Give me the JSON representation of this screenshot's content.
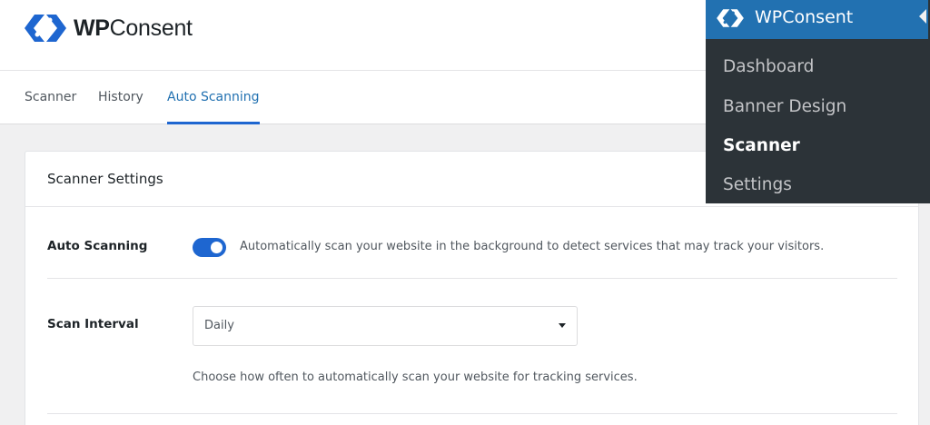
{
  "brand": {
    "name_bold": "WP",
    "name_rest": "Consent"
  },
  "tabs": [
    {
      "label": "Scanner",
      "active": false
    },
    {
      "label": "History",
      "active": false
    },
    {
      "label": "Auto Scanning",
      "active": true
    }
  ],
  "card": {
    "title": "Scanner Settings",
    "auto_scanning": {
      "label": "Auto Scanning",
      "enabled": true,
      "description": "Automatically scan your website in the background to detect services that may track your visitors."
    },
    "scan_interval": {
      "label": "Scan Interval",
      "selected": "Daily",
      "help": "Choose how often to automatically scan your website for tracking services."
    }
  },
  "flyout": {
    "title": "WPConsent",
    "items": [
      {
        "label": "Dashboard",
        "current": false
      },
      {
        "label": "Banner Design",
        "current": false
      },
      {
        "label": "Scanner",
        "current": true
      },
      {
        "label": "Settings",
        "current": false
      }
    ]
  },
  "colors": {
    "accent": "#1e66d0",
    "admin_blue": "#2271b1",
    "admin_dark": "#2c3338",
    "page_bg": "#f0f0f1"
  },
  "icons": {
    "logo": "wpconsent-logo-icon",
    "flyout_logo": "wpconsent-logo-icon"
  }
}
